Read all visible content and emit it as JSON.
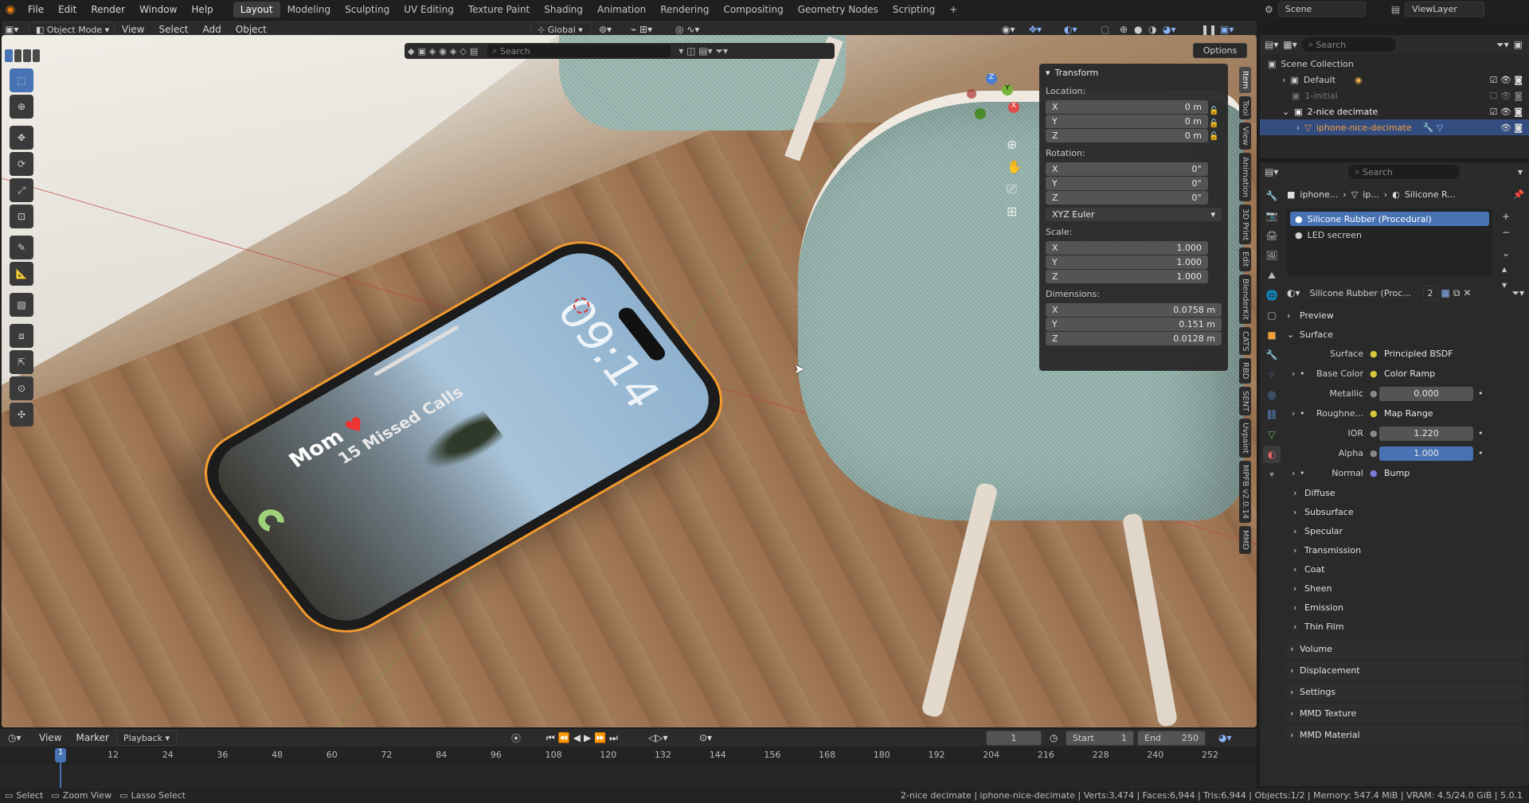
{
  "menu": {
    "items": [
      "File",
      "Edit",
      "Render",
      "Window",
      "Help"
    ]
  },
  "workspaces": {
    "tabs": [
      "Layout",
      "Modeling",
      "Sculpting",
      "UV Editing",
      "Texture Paint",
      "Shading",
      "Animation",
      "Rendering",
      "Compositing",
      "Geometry Nodes",
      "Scripting"
    ],
    "active": "Layout"
  },
  "scene_selector": {
    "scene": "Scene",
    "view_layer": "ViewLayer"
  },
  "viewport_header": {
    "mode": "Object Mode",
    "menus": [
      "View",
      "Select",
      "Add",
      "Object"
    ],
    "transform_orientation": "Global",
    "options_label": "Options"
  },
  "viewport_toolbar": {
    "search_placeholder": "Search"
  },
  "phone_screen": {
    "time": "09:14",
    "missed": "15 Missed Calls",
    "caller": "Mom"
  },
  "npanel": {
    "title": "Transform",
    "location_label": "Location:",
    "location": [
      {
        "axis": "X",
        "value": "0 m"
      },
      {
        "axis": "Y",
        "value": "0 m"
      },
      {
        "axis": "Z",
        "value": "0 m"
      }
    ],
    "rotation_label": "Rotation:",
    "rotation": [
      {
        "axis": "X",
        "value": "0°"
      },
      {
        "axis": "Y",
        "value": "0°"
      },
      {
        "axis": "Z",
        "value": "0°"
      }
    ],
    "rotation_mode": "XYZ Euler",
    "scale_label": "Scale:",
    "scale": [
      {
        "axis": "X",
        "value": "1.000"
      },
      {
        "axis": "Y",
        "value": "1.000"
      },
      {
        "axis": "Z",
        "value": "1.000"
      }
    ],
    "dimensions_label": "Dimensions:",
    "dimensions": [
      {
        "axis": "X",
        "value": "0.0758 m"
      },
      {
        "axis": "Y",
        "value": "0.151 m"
      },
      {
        "axis": "Z",
        "value": "0.0128 m"
      }
    ]
  },
  "sidebar_tabs": [
    "Item",
    "Tool",
    "View",
    "Animation",
    "3D Print",
    "Edit",
    "BlenderKit",
    "CATS",
    "RBD",
    "SENT",
    "Uvpaint",
    "MPFB v2.0.14",
    "MMD"
  ],
  "timeline": {
    "menus": [
      "View",
      "Marker"
    ],
    "playback_label": "Playback",
    "current_frame": "1",
    "start_label": "Start",
    "start": "1",
    "end_label": "End",
    "end": "250",
    "ticks": [
      "1",
      "12",
      "24",
      "36",
      "48",
      "60",
      "72",
      "84",
      "96",
      "108",
      "120",
      "132",
      "144",
      "156",
      "168",
      "180",
      "192",
      "204",
      "216",
      "228",
      "240",
      "252"
    ]
  },
  "statusbar": {
    "select": "Select",
    "zoom": "Zoom View",
    "lasso": "Lasso Select",
    "info": "2-nice decimate | iphone-nice-decimate | Verts:3,474 | Faces:6,944 | Tris:6,944 | Objects:1/2 | Memory: 547.4 MiB | VRAM: 4.5/24.0 GiB | 5.0.1"
  },
  "outliner": {
    "search_placeholder": "Search",
    "root": "Scene Collection",
    "items": [
      {
        "label": "Default"
      },
      {
        "label": "1-initial"
      },
      {
        "label": "2-nice decimate"
      },
      {
        "label": "iphone-nice-decimate"
      }
    ]
  },
  "properties": {
    "search_placeholder": "Search",
    "breadcrumb": [
      "iphone...",
      "ip...",
      "Silicone R..."
    ],
    "material_slots": [
      "Silicone Rubber (Procedural)",
      "LED secreen"
    ],
    "material_name": "Silicone Rubber (Proc...",
    "material_users": "2",
    "sections_top": [
      "Preview",
      "Surface"
    ],
    "surface_rows": [
      {
        "label": "Surface",
        "value": "Principled BSDF",
        "kind": "link"
      },
      {
        "label": "Base Color",
        "value": "Color Ramp",
        "kind": "link",
        "expand": true
      },
      {
        "label": "Metallic",
        "value": "0.000",
        "kind": "num"
      },
      {
        "label": "Roughne...",
        "value": "Map Range",
        "kind": "link",
        "expand": true
      },
      {
        "label": "IOR",
        "value": "1.220",
        "kind": "num"
      },
      {
        "label": "Alpha",
        "value": "1.000",
        "kind": "num-full"
      },
      {
        "label": "Normal",
        "value": "Bump",
        "kind": "link",
        "expand": true
      }
    ],
    "subsections": [
      "Diffuse",
      "Subsurface",
      "Specular",
      "Transmission",
      "Coat",
      "Sheen",
      "Emission",
      "Thin Film"
    ],
    "sections_bottom": [
      "Volume",
      "Displacement",
      "Settings",
      "MMD Texture",
      "MMD Material"
    ]
  }
}
